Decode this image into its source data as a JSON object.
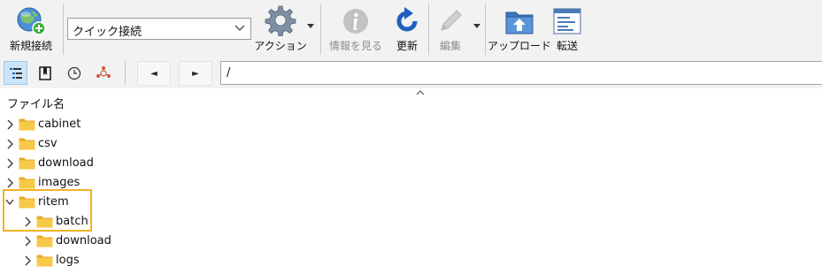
{
  "toolbar": {
    "new_connection": "新規接続",
    "quick_connect": "クイック接続",
    "action": "アクション",
    "info": "情報を見る",
    "refresh": "更新",
    "edit": "編集",
    "upload": "アップロード",
    "transfer": "転送"
  },
  "navbar": {
    "path": "/",
    "back_icon": "◄",
    "forward_icon": "►"
  },
  "columns": {
    "filename": "ファイル名"
  },
  "tree": [
    {
      "name": "cabinet",
      "level": 0,
      "expanded": false
    },
    {
      "name": "csv",
      "level": 0,
      "expanded": false
    },
    {
      "name": "download",
      "level": 0,
      "expanded": false
    },
    {
      "name": "images",
      "level": 0,
      "expanded": false
    },
    {
      "name": "ritem",
      "level": 0,
      "expanded": true
    },
    {
      "name": "batch",
      "level": 1,
      "expanded": false
    },
    {
      "name": "download",
      "level": 1,
      "expanded": false
    },
    {
      "name": "logs",
      "level": 1,
      "expanded": false
    }
  ],
  "colors": {
    "highlight": "#f0b323",
    "folder": "#f7c948",
    "accent": "#2f72c9"
  }
}
